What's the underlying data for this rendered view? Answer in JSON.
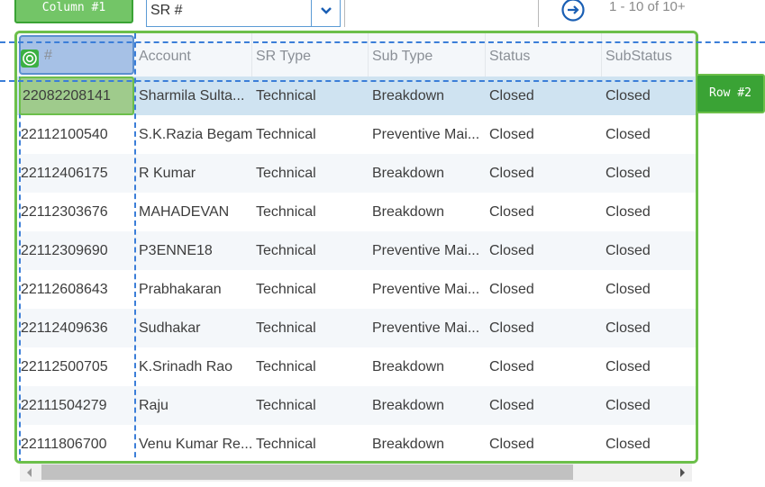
{
  "toolbar": {
    "search_field": "SR #",
    "search_value": "",
    "page_info": "1 - 10 of 10+"
  },
  "annotations": {
    "column_badge": "Column #1",
    "row_badge": "Row #2"
  },
  "table": {
    "columns": [
      "#",
      "Account",
      "SR Type",
      "Sub Type",
      "Status",
      "SubStatus"
    ],
    "rows": [
      [
        "22082208141",
        "Sharmila Sulta...",
        "Technical",
        "Breakdown",
        "Closed",
        "Closed"
      ],
      [
        "22112100540",
        "S.K.Razia Begam",
        "Technical",
        "Preventive Mai...",
        "Closed",
        "Closed"
      ],
      [
        "22112406175",
        "R Kumar",
        "Technical",
        "Breakdown",
        "Closed",
        "Closed"
      ],
      [
        "22112303676",
        "MAHADEVAN",
        "Technical",
        "Breakdown",
        "Closed",
        "Closed"
      ],
      [
        "22112309690",
        "P3ENNE18",
        "Technical",
        "Preventive Mai...",
        "Closed",
        "Closed"
      ],
      [
        "22112608643",
        "Prabhakaran",
        "Technical",
        "Preventive Mai...",
        "Closed",
        "Closed"
      ],
      [
        "22112409636",
        "Sudhakar",
        "Technical",
        "Preventive Mai...",
        "Closed",
        "Closed"
      ],
      [
        "22112500705",
        "K.Srinadh Rao",
        "Technical",
        "Breakdown",
        "Closed",
        "Closed"
      ],
      [
        "22111504279",
        "Raju",
        "Technical",
        "Breakdown",
        "Closed",
        "Closed"
      ],
      [
        "22111806700",
        "Venu Kumar Re...",
        "Technical",
        "Breakdown",
        "Closed",
        "Closed"
      ]
    ]
  },
  "colors": {
    "selection_green": "#6cbf4a",
    "selection_blue": "#3b7ed8",
    "selected_row": "#cfe3f1"
  }
}
